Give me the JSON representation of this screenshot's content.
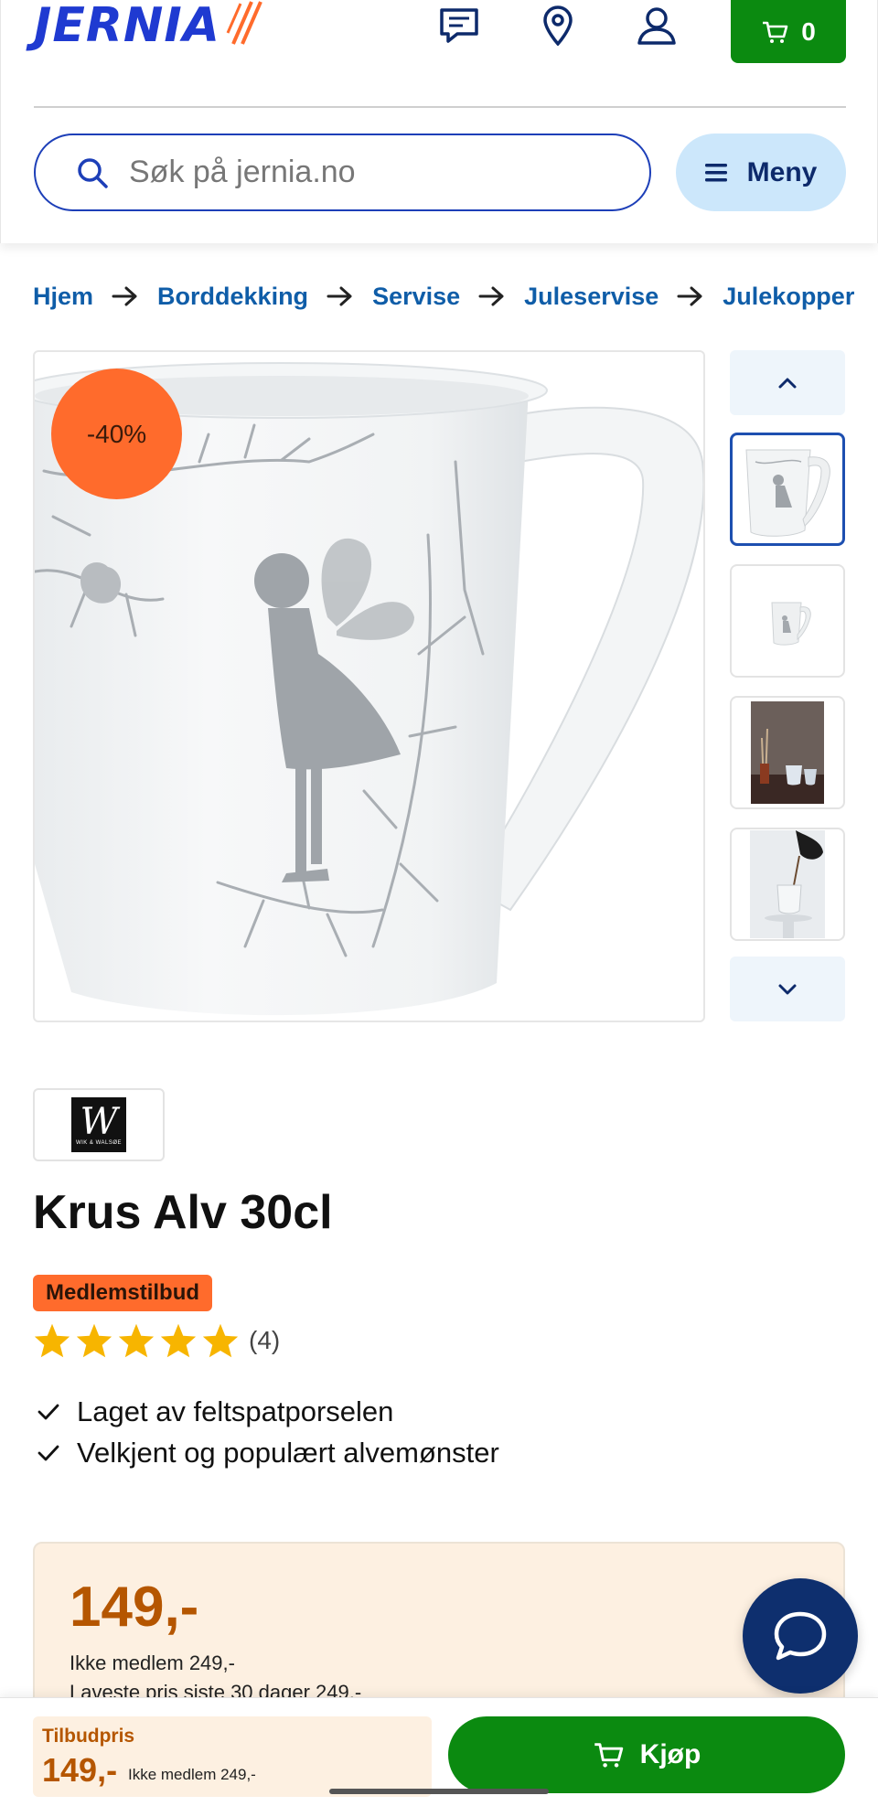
{
  "header": {
    "logo_text": "JERNIA",
    "cart_count": "0",
    "icons": [
      "chat-icon",
      "location-pin-icon",
      "user-icon",
      "cart-icon"
    ],
    "search_placeholder": "Søk på jernia.no",
    "menu_label": "Meny"
  },
  "breadcrumb": [
    "Hjem",
    "Borddekking",
    "Servise",
    "Juleservise",
    "Julekopper"
  ],
  "gallery": {
    "discount_badge": "-40%",
    "thumbnail_count": 4,
    "active_thumbnail": 1
  },
  "product": {
    "brand_logo": "WIK & WALSØE",
    "title": "Krus Alv 30cl",
    "badge": "Medlemstilbud",
    "rating": 5,
    "review_count": "(4)",
    "usps": [
      "Laget av feltspatporselen",
      "Velkjent og populært alvemønster"
    ]
  },
  "price": {
    "price": "149,-",
    "non_member": "Ikke medlem 249,-",
    "lowest_30_days": "Laveste pris siste 30 dager 249,-"
  },
  "footer": {
    "offer_label": "Tilbudpris",
    "offer_price": "149,-",
    "offer_non_member": "Ikke medlem 249,-",
    "buy_label": "Kjøp"
  },
  "colors": {
    "brand_blue": "#1f3ad1",
    "link_blue": "#0f5da8",
    "cart_green": "#0b8a10",
    "discount_orange": "#ff6b2c",
    "price_orange": "#b55600",
    "price_bg": "#fdf0e1",
    "chat_navy": "#0e2f6e",
    "menu_bg": "#cce7fb"
  }
}
